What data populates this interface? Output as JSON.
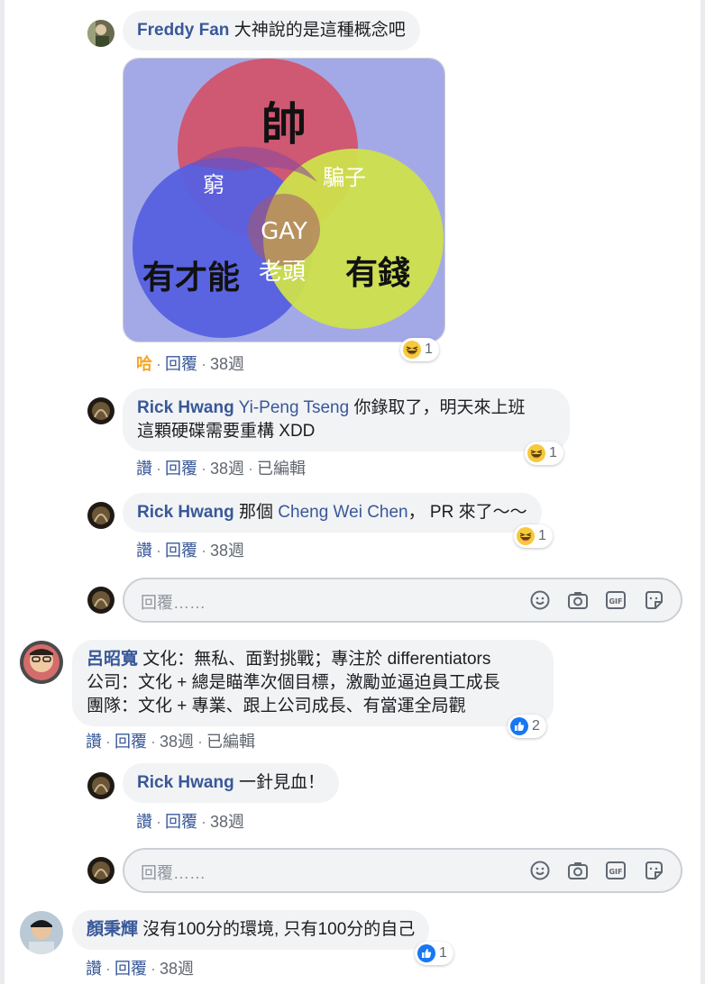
{
  "thread": [
    {
      "author": "Freddy Fan",
      "text": "大神說的是這種概念吧",
      "image": {
        "top": "帥",
        "left": "有才能",
        "right": "有錢",
        "top_left": "窮",
        "top_right": "騙子",
        "center": "GAY",
        "bottom": "老頭"
      },
      "meta": {
        "like": "哈",
        "reply": "回覆",
        "time": "38週"
      },
      "reaction": {
        "type": "haha",
        "count": "1"
      }
    },
    {
      "author": "Rick Hwang",
      "mention": "Yi-Peng Tseng",
      "text1": "你錄取了，明天來上班",
      "text2": "這顆硬碟需要重構 XDD",
      "meta": {
        "like": "讚",
        "reply": "回覆",
        "time": "38週",
        "edited": "已編輯"
      },
      "reaction": {
        "type": "haha",
        "count": "1"
      }
    },
    {
      "author": "Rick Hwang",
      "pre": "那個",
      "mention": "Cheng Wei Chen",
      "text": "， PR 來了～～",
      "meta": {
        "like": "讚",
        "reply": "回覆",
        "time": "38週"
      },
      "reaction": {
        "type": "haha",
        "count": "1"
      }
    }
  ],
  "reply_box_1": {
    "placeholder": "回覆……"
  },
  "comment_lu": {
    "author": "呂昭寬",
    "line1": "文化：無私、面對挑戰；專注於 differentiators",
    "line2": "公司：文化 + 總是瞄準次個目標，激勵並逼迫員工成長",
    "line3": "團隊：文化 + 專業、跟上公司成長、有當運全局觀",
    "meta": {
      "like": "讚",
      "reply": "回覆",
      "time": "38週",
      "edited": "已編輯"
    },
    "reaction": {
      "type": "like",
      "count": "2"
    }
  },
  "reply_rick_3": {
    "author": "Rick Hwang",
    "text": "一針見血！",
    "meta": {
      "like": "讚",
      "reply": "回覆",
      "time": "38週"
    }
  },
  "reply_box_2": {
    "placeholder": "回覆……"
  },
  "comment_yan": {
    "author": "顏秉輝",
    "text": "沒有100分的環境, 只有100分的自己",
    "meta": {
      "like": "讚",
      "reply": "回覆",
      "time": "38週"
    },
    "reaction": {
      "type": "like",
      "count": "1"
    }
  },
  "colors": {
    "link": "#385898",
    "bubble": "#f2f3f5",
    "haha": "#f5a623",
    "like": "#1877f2"
  }
}
